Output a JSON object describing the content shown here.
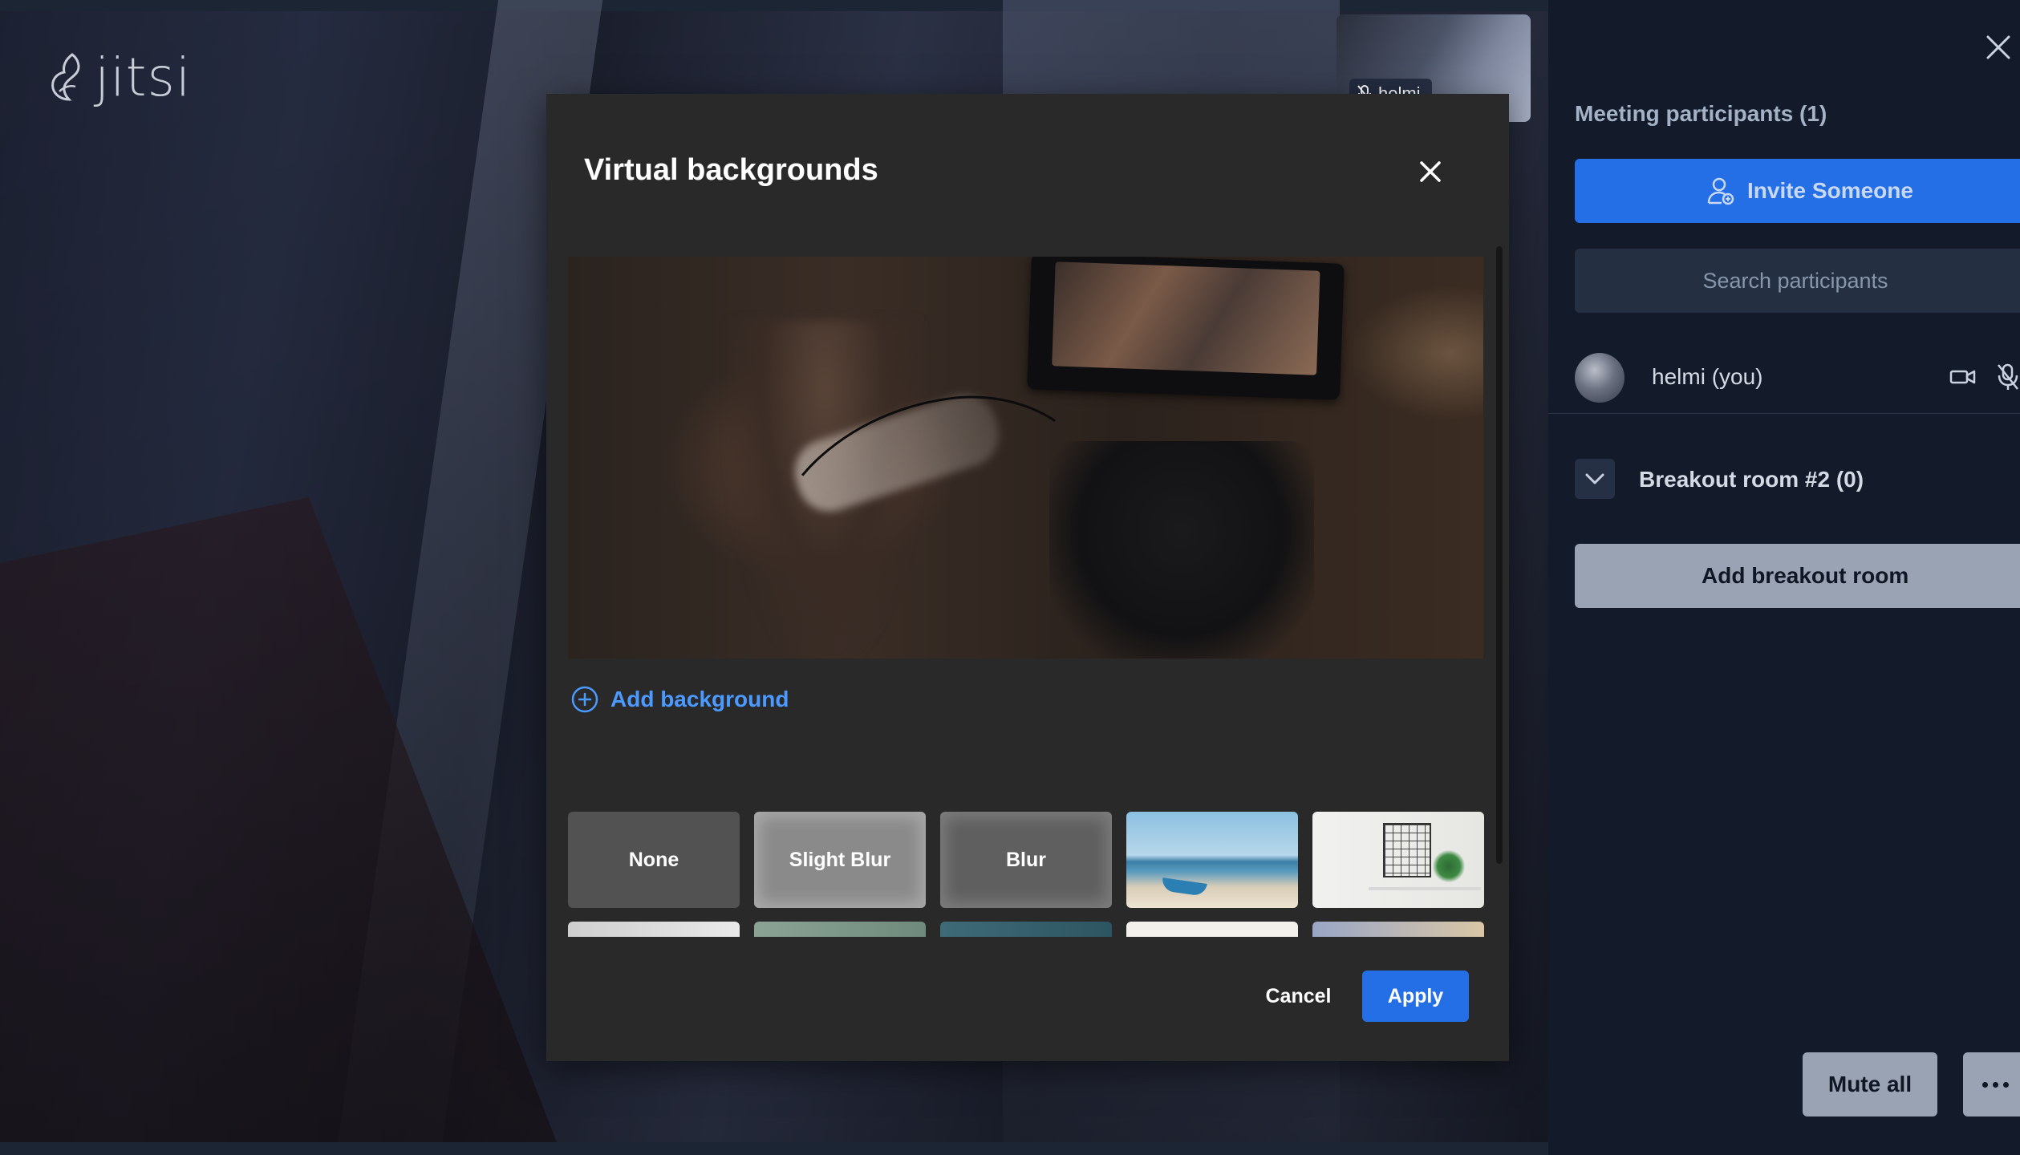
{
  "app": {
    "logo_text": "jitsi"
  },
  "stage": {
    "thumbnail_name": "helmi"
  },
  "modal": {
    "title": "Virtual backgrounds",
    "add_background_label": "Add background",
    "tiles": [
      {
        "label": "None"
      },
      {
        "label": "Slight Blur"
      },
      {
        "label": "Blur"
      }
    ],
    "cancel_label": "Cancel",
    "apply_label": "Apply"
  },
  "panel": {
    "title": "Meeting participants (1)",
    "invite_label": "Invite Someone",
    "search_placeholder": "Search participants",
    "participants": [
      {
        "name": "helmi (you)"
      }
    ],
    "breakout_room_label": "Breakout room #2 (0)",
    "add_breakout_label": "Add breakout room",
    "mute_all_label": "Mute all"
  },
  "colors": {
    "accent": "#246fe5",
    "link": "#4c9aff",
    "panel_bg": "#131b2b",
    "modal_bg": "#292929"
  }
}
